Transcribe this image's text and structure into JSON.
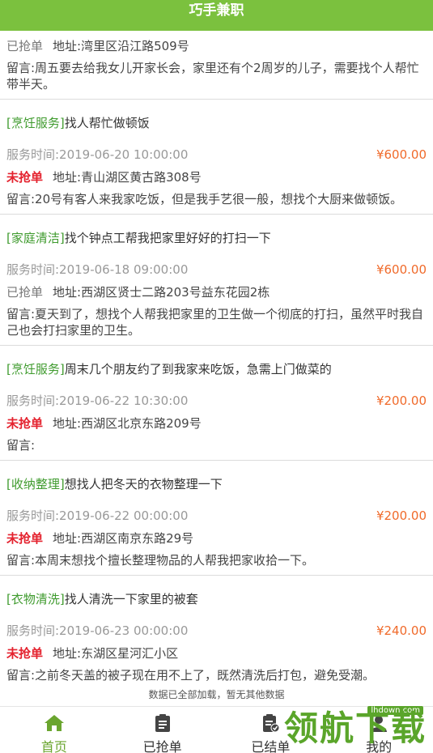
{
  "header": {
    "title": "巧手兼职"
  },
  "orders": [
    {
      "category": "",
      "title": "",
      "time": "",
      "price": "",
      "status": "已抢单",
      "address": "地址:湾里区沿江路509号",
      "message": "留言:周五要去给我女儿开家长会，家里还有个2周岁的儿子，需要找个人帮忙带半天。"
    },
    {
      "category": "[烹饪服务]",
      "title": "找人帮忙做顿饭",
      "time": "服务时间:2019-06-20 10:00:00",
      "price": "¥600.00",
      "status": "未抢单",
      "address": "地址:青山湖区黄古路308号",
      "message": "留言:20号有客人来我家吃饭，但是我手艺很一般，想找个大厨来做顿饭。"
    },
    {
      "category": "[家庭清洁]",
      "title": "找个钟点工帮我把家里好好的打扫一下",
      "time": "服务时间:2019-06-18 09:00:00",
      "price": "¥600.00",
      "status": "已抢单",
      "address": "地址:西湖区贤士二路203号益东花园2栋",
      "message": "留言:夏天到了，想找个人帮我把家里的卫生做一个彻底的打扫，虽然平时我自己也会打扫家里的卫生。"
    },
    {
      "category": "[烹饪服务]",
      "title": "周末几个朋友约了到我家来吃饭，急需上门做菜的",
      "time": "服务时间:2019-06-22 10:30:00",
      "price": "¥200.00",
      "status": "未抢单",
      "address": "地址:西湖区北京东路209号",
      "message": "留言:"
    },
    {
      "category": "[收纳整理]",
      "title": "想找人把冬天的衣物整理一下",
      "time": "服务时间:2019-06-22 00:00:00",
      "price": "¥200.00",
      "status": "未抢单",
      "address": "地址:西湖区南京东路29号",
      "message": "留言:本周末想找个擅长整理物品的人帮我把家收拾一下。"
    },
    {
      "category": "[衣物清洗]",
      "title": "找人清洗一下家里的被套",
      "time": "服务时间:2019-06-23 00:00:00",
      "price": "¥240.00",
      "status": "未抢单",
      "address": "地址:东湖区星河汇小区",
      "message": "留言:之前冬天盖的被子现在用不上了，既然清洗后打包，避免受潮。"
    }
  ],
  "footer_note": "数据已全部加载，暂无其他数据",
  "tabs": [
    {
      "label": "首页",
      "icon": "home-icon",
      "active": true
    },
    {
      "label": "已抢单",
      "icon": "clipboard-icon",
      "active": false
    },
    {
      "label": "已结单",
      "icon": "clipboard-check-icon",
      "active": false
    },
    {
      "label": "我的",
      "icon": "user-icon",
      "active": false
    }
  ],
  "watermark": {
    "text": "领航下载",
    "site": "lhdown.com"
  },
  "colors": {
    "brand_green": "#7bc13e",
    "category_green": "#3f9b2e",
    "price_orange": "#f06a2a",
    "open_status_red": "#e4222e"
  }
}
